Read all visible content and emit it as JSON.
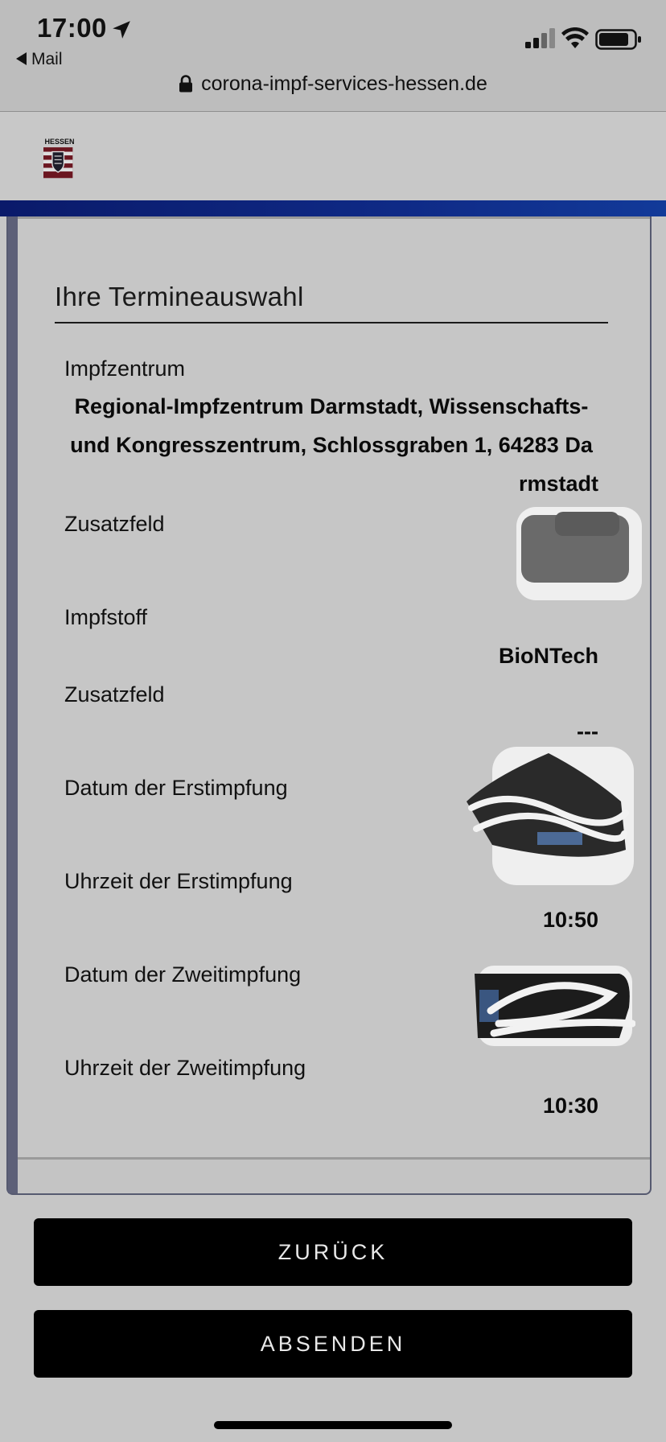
{
  "status_bar": {
    "time": "17:00",
    "back_app": "Mail"
  },
  "browser": {
    "url": "corona-impf-services-hessen.de"
  },
  "site": {
    "logo_text": "HESSEN"
  },
  "card": {
    "title": "Ihre Termineauswahl",
    "fields": [
      {
        "label": "Impfzentrum",
        "value": "Regional-Impfzentrum Darmstadt, Wissenschafts- und Kongresszentrum, Schlossgraben 1, 64283 Da rmstadt"
      },
      {
        "label": "Zusatzfeld",
        "value": ""
      },
      {
        "label": "Impfstoff",
        "value": "BioNTech"
      },
      {
        "label": "Zusatzfeld",
        "value": "---"
      },
      {
        "label": "Datum der Erstimpfung",
        "value": ""
      },
      {
        "label": "Uhrzeit der Erstimpfung",
        "value": "10:50"
      },
      {
        "label": "Datum der Zweitimpfung",
        "value": ""
      },
      {
        "label": "Uhrzeit der Zweitimpfung",
        "value": "10:30"
      }
    ],
    "vaccine_center_lines": [
      "Regional-Impfzentrum Darmstadt, Wissenschafts-",
      "und Kongresszentrum, Schlossgraben 1, 64283 Da",
      "rmstadt"
    ]
  },
  "buttons": {
    "back": "ZURÜCK",
    "submit": "ABSENDEN"
  },
  "colors": {
    "page_bg": "#c6c6c6",
    "header_band": "#0f2a86",
    "button_bg": "#000000",
    "button_text": "#e8e8e8"
  },
  "icons": {
    "location": "location-arrow-icon",
    "signal": "cellular-signal-icon",
    "wifi": "wifi-icon",
    "battery": "battery-icon",
    "lock": "lock-icon",
    "logo": "hessen-coat-of-arms-icon"
  }
}
